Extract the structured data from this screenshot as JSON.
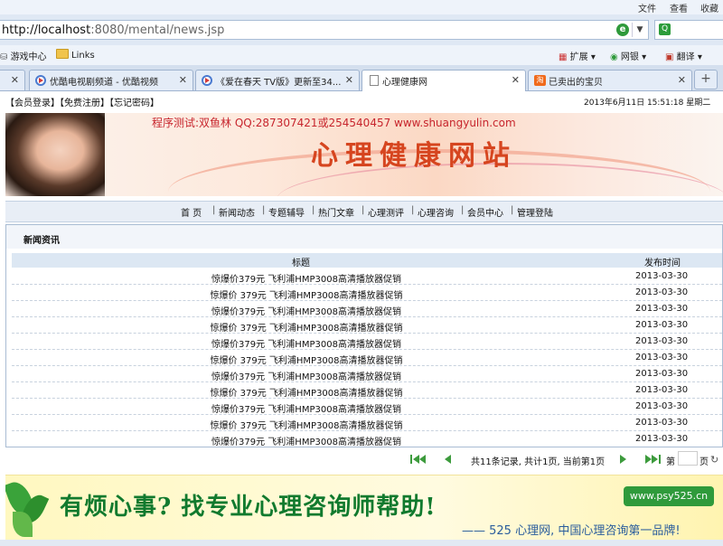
{
  "browser": {
    "menu": [
      "文件",
      "查看",
      "收藏"
    ],
    "url_host": "http://localhost",
    "url_path": ":8080/mental/news.jsp",
    "favorites": [
      "游戏中心",
      "Links"
    ],
    "right_tools": [
      "扩展",
      "网银",
      "翻译"
    ],
    "tabs": [
      {
        "label": "优酷电视剧频道 - 优酷视频"
      },
      {
        "label": "《爱在春天 TV版》更新至34..."
      },
      {
        "label": "心理健康网"
      },
      {
        "label": "已卖出的宝贝"
      }
    ]
  },
  "page": {
    "top_links": "【会员登录】【免费注册】【忘记密码】",
    "datetime": "2013年6月11日  15:51:18   星期二",
    "banner_test": "程序测试:双鱼林 QQ:287307421或254540457 www.shuangyulin.com",
    "banner_title": "心理健康网站",
    "nav": [
      "首 页",
      "新闻动态",
      "专题辅导",
      "热门文章",
      "心理测评",
      "心理咨询",
      "会员中心",
      "管理登陆"
    ],
    "news_box_title": "新闻资讯",
    "table_headers": {
      "title": "标题",
      "date": "发布时间"
    },
    "rows": [
      {
        "title": "惊爆价379元  飞利浦HMP3008高清播放器促销",
        "date": "2013-03-30"
      },
      {
        "title": "惊爆价 379元  飞利浦HMP3008高清播放器促销",
        "date": "2013-03-30"
      },
      {
        "title": "惊爆价379元  飞利浦HMP3008高清播放器促销",
        "date": "2013-03-30"
      },
      {
        "title": "惊爆价 379元  飞利浦HMP3008高清播放器促销",
        "date": "2013-03-30"
      },
      {
        "title": "惊爆价379元  飞利浦HMP3008高清播放器促销",
        "date": "2013-03-30"
      },
      {
        "title": "惊爆价 379元  飞利浦HMP3008高清播放器促销",
        "date": "2013-03-30"
      },
      {
        "title": "惊爆价379元  飞利浦HMP3008高清播放器促销",
        "date": "2013-03-30"
      },
      {
        "title": "惊爆价 379元  飞利浦HMP3008高清播放器促销",
        "date": "2013-03-30"
      },
      {
        "title": "惊爆价379元  飞利浦HMP3008高清播放器促销",
        "date": "2013-03-30"
      },
      {
        "title": "惊爆价 379元  飞利浦HMP3008高清播放器促销",
        "date": "2013-03-30"
      },
      {
        "title": "惊爆价379元  飞利浦HMP3008高清播放器促销",
        "date": "2013-03-30"
      }
    ],
    "pager_info": "共11条记录, 共计1页, 当前第1页",
    "pager_go_prefix": "第",
    "pager_go_suffix": "页",
    "ad_main": "有烦心事? 找专业心理咨询师帮助!",
    "ad_url": "www.psy525.cn",
    "ad_sub": "—— 525 心理网, 中国心理咨询第一品牌!"
  }
}
